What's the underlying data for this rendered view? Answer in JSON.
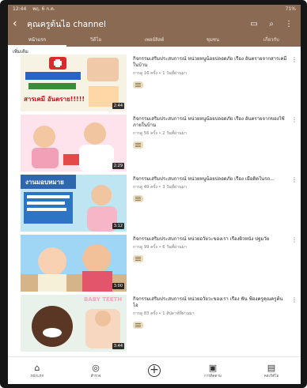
{
  "status": {
    "time": "12:44",
    "date": "พฤ. 6 ก.ค.",
    "battery": "71%"
  },
  "appbar": {
    "title": "คุณครูต้นไอ channel"
  },
  "tabs": [
    {
      "label": "หน้าแรก"
    },
    {
      "label": "วิดีโอ"
    },
    {
      "label": "เพลย์ลิสต์"
    },
    {
      "label": "ชุมชน"
    },
    {
      "label": "เกี่ยวกับ"
    }
  ],
  "list": {
    "header": "เพิ่มเติม"
  },
  "videos": [
    {
      "title": "กิจกรรมเสริมประสบการณ์ หน่วยหนูน้อยปลอดภัย เรื่อง อันตรายจากสารเคมีในบ้าน",
      "sub": "การดู 16 ครั้ง • 1 วันที่ผ่านมา",
      "duration": "2:44",
      "thumb_text": "สารเคมี อันตราย!!!!!"
    },
    {
      "title": "กิจกรรมเสริมประสบการณ์ หน่วยหนูน้อยปลอดภัย เรื่อง อันตรายจากของใช้ภายในบ้าน",
      "sub": "การดู 56 ครั้ง • 2 วันที่ผ่านมา",
      "duration": "2:29",
      "thumb_text": ""
    },
    {
      "title": "กิจกรรมเสริมประสบการณ์ หน่วยหนูน้อยปลอดภัย เรื่อง เมื่อติดในรถ...",
      "sub": "การดู 49 ครั้ง • 3 วันที่ผ่านมา",
      "duration": "3:12",
      "thumb_text": "งานมอบหมาย"
    },
    {
      "title": "กิจกรรมเสริมประสบการณ์ หน่วยอวัยวะของเรา เรื่องผิวหนัง ปฐมวัย",
      "sub": "การดู 99 ครั้ง • 6 วันที่ผ่านมา",
      "duration": "3:00",
      "thumb_text": ""
    },
    {
      "title": "กิจกรรมเสริมประสบการณ์ หน่วยอวัยวะของเรา เรื่อง ฟัน ฟ้องครูคุณครูต้นไอ",
      "sub": "การดู 83 ครั้ง • 1 สัปดาห์ที่ผ่านมา",
      "duration": "3:44",
      "thumb_text": "BABY TEETH"
    }
  ],
  "nav": [
    {
      "label": "หน้าแรก",
      "icon": "home-icon"
    },
    {
      "label": "สำรวจ",
      "icon": "explore-icon"
    },
    {
      "label": "",
      "icon": "add-icon"
    },
    {
      "label": "การติดตาม",
      "icon": "subscriptions-icon"
    },
    {
      "label": "คลังวิดีโอ",
      "icon": "library-icon"
    }
  ],
  "colors": {
    "appbar": "#8a6a52",
    "tab_text": "#f1e4d6"
  }
}
